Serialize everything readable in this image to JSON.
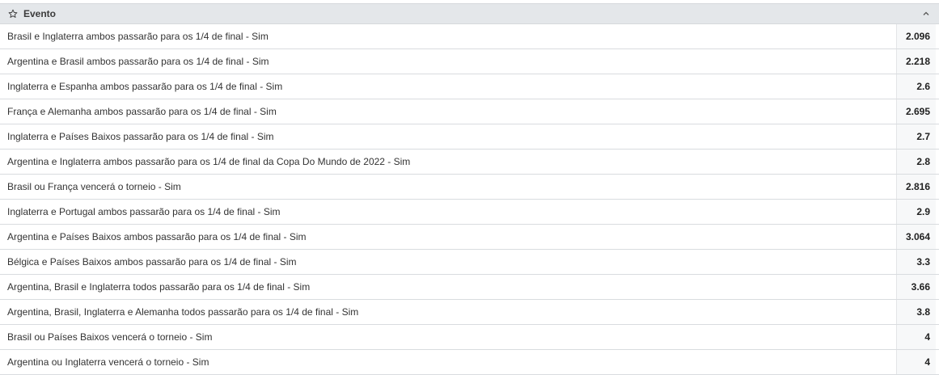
{
  "header": {
    "title": "Evento",
    "star_icon": "star-outline-icon",
    "collapse_icon": "chevron-up-icon"
  },
  "rows": [
    {
      "label": "Brasil e Inglaterra ambos passarão para os 1/4 de final - Sim",
      "odds": "2.096"
    },
    {
      "label": "Argentina e Brasil ambos passarão para os 1/4 de final - Sim",
      "odds": "2.218"
    },
    {
      "label": "Inglaterra e Espanha ambos passarão para os 1/4 de final - Sim",
      "odds": "2.6"
    },
    {
      "label": "França e Alemanha ambos passarão para os 1/4 de final - Sim",
      "odds": "2.695"
    },
    {
      "label": "Inglaterra e Países Baixos passarão para os 1/4 de final - Sim",
      "odds": "2.7"
    },
    {
      "label": "Argentina e Inglaterra ambos passarão para os 1/4 de final da Copa Do Mundo de 2022 - Sim",
      "odds": "2.8"
    },
    {
      "label": "Brasil ou França vencerá o torneio - Sim",
      "odds": "2.816"
    },
    {
      "label": "Inglaterra e Portugal ambos passarão para os 1/4 de final - Sim",
      "odds": "2.9"
    },
    {
      "label": "Argentina e Países Baixos ambos passarão para os 1/4 de final - Sim",
      "odds": "3.064"
    },
    {
      "label": "Bélgica e Países Baixos ambos passarão para os 1/4 de final - Sim",
      "odds": "3.3"
    },
    {
      "label": "Argentina, Brasil e Inglaterra todos passarão para os 1/4 de final - Sim",
      "odds": "3.66"
    },
    {
      "label": "Argentina, Brasil, Inglaterra e Alemanha todos passarão para os 1/4 de final - Sim",
      "odds": "3.8"
    },
    {
      "label": "Brasil ou Países Baixos vencerá o torneio - Sim",
      "odds": "4"
    },
    {
      "label": "Argentina ou Inglaterra vencerá o torneio - Sim",
      "odds": "4"
    }
  ]
}
